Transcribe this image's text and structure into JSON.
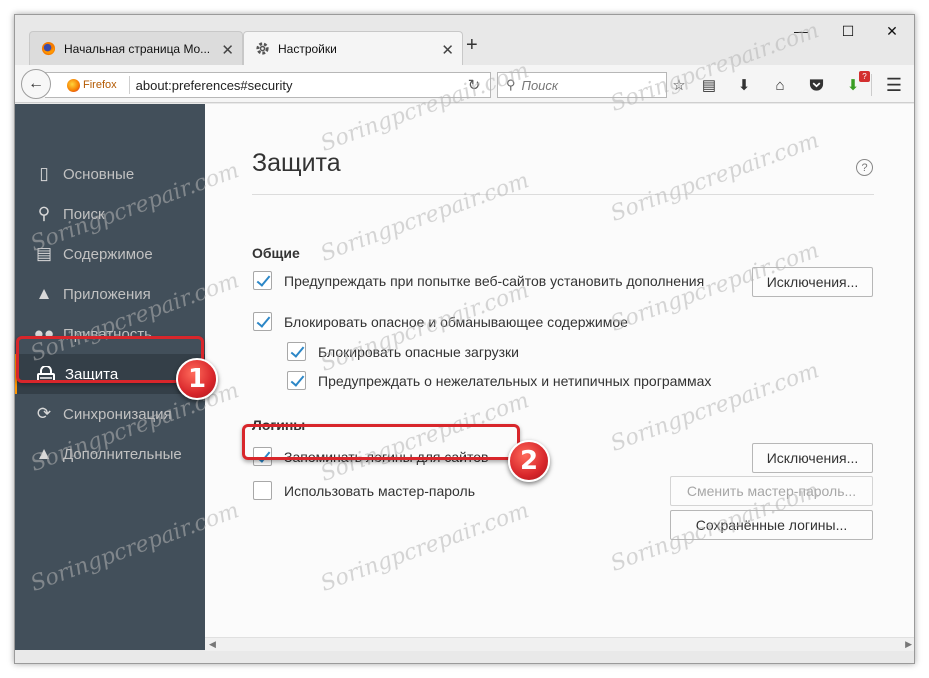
{
  "tabs": [
    {
      "title": "Начальная страница Mo...",
      "icon": "firefox-icon"
    },
    {
      "title": "Настройки",
      "icon": "gear-icon"
    }
  ],
  "new_tab_symbol": "+",
  "window_controls": {
    "minimize": "—",
    "maximize": "☐",
    "close": "✕"
  },
  "navbar": {
    "identity_label": "Firefox",
    "url": "about:preferences#security",
    "search_placeholder": "Поиск"
  },
  "toolbar_badge": "?",
  "sidebar": {
    "items": [
      {
        "label": "Основные",
        "icon": "general-icon"
      },
      {
        "label": "Поиск",
        "icon": "search-icon"
      },
      {
        "label": "Содержимое",
        "icon": "content-icon"
      },
      {
        "label": "Приложения",
        "icon": "rocket-icon"
      },
      {
        "label": "Приватность",
        "icon": "mask-icon"
      },
      {
        "label": "Защита",
        "icon": "lock-icon",
        "active": true
      },
      {
        "label": "Синхронизация",
        "icon": "sync-icon"
      },
      {
        "label": "Дополнительные",
        "icon": "wizard-icon"
      }
    ]
  },
  "main": {
    "title": "Защита",
    "help_symbol": "?",
    "general": {
      "heading": "Общие",
      "warn_addons": {
        "label": "Предупреждать при попытке веб-сайтов установить дополнения",
        "checked": true
      },
      "exceptions_button": "Исключения...",
      "block_dangerous": {
        "label": "Блокировать опасное и обманывающее содержимое",
        "checked": true
      },
      "block_downloads": {
        "label": "Блокировать опасные загрузки",
        "checked": true
      },
      "warn_unwanted": {
        "label": "Предупреждать о нежелательных и нетипичных программах",
        "checked": true
      }
    },
    "logins": {
      "heading": "Логины",
      "remember_logins": {
        "label": "Запоминать логины для сайтов",
        "checked": true
      },
      "exceptions_button": "Исключения...",
      "master_password": {
        "label": "Использовать мастер-пароль",
        "checked": false
      },
      "change_master_button": "Сменить мастер-пароль...",
      "saved_logins_button": "Сохранённые логины..."
    }
  },
  "annotations": {
    "marker1": "1",
    "marker2": "2",
    "color": "#d8262b"
  },
  "watermark": "Soringpcrepair.com",
  "colors": {
    "sidebar_bg": "#424f5a",
    "sidebar_active": "#343f48",
    "checkmark": "#2c87c7",
    "accent_orange": "#ff9500"
  }
}
